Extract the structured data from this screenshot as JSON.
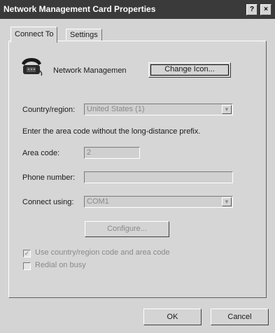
{
  "window": {
    "title": "Network Management Card Properties",
    "help_glyph": "?",
    "close_glyph": "×"
  },
  "tabs": [
    {
      "label": "Connect To",
      "active": true
    },
    {
      "label": "Settings",
      "active": false
    }
  ],
  "connection": {
    "name": "Network Managemen",
    "change_icon_label": "Change Icon..."
  },
  "form": {
    "country_label": "Country/region:",
    "country_value": "United States (1)",
    "area_hint": "Enter the area code without the long-distance prefix.",
    "area_label": "Area code:",
    "area_value": "2",
    "phone_label": "Phone number:",
    "phone_value": "",
    "connect_label": "Connect using:",
    "connect_value": "COM1",
    "configure_label": "Configure...",
    "use_country_label": "Use country/region code and area code",
    "use_country_checked": true,
    "redial_label": "Redial on busy",
    "redial_checked": false
  },
  "footer": {
    "ok_label": "OK",
    "cancel_label": "Cancel"
  },
  "icons": {
    "phone_icon": "telephone-icon",
    "dropdown_arrow": "▼",
    "check_mark": "✓"
  }
}
